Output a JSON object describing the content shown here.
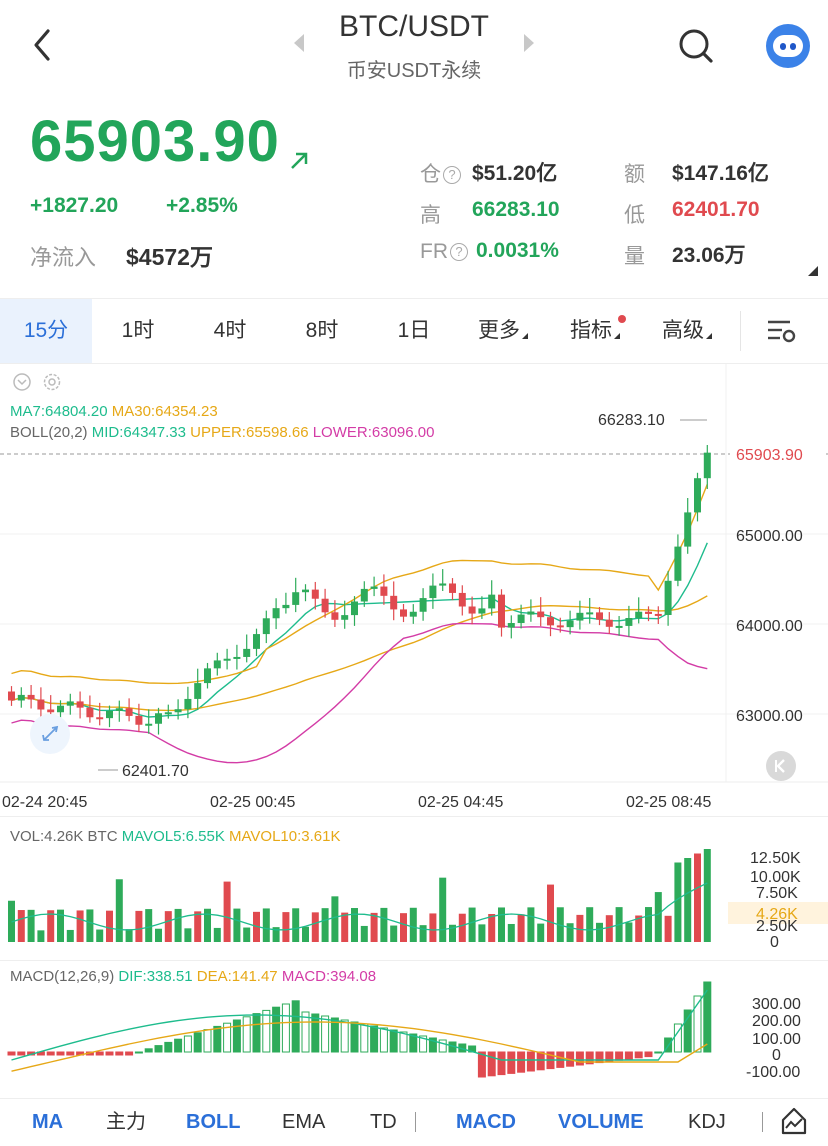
{
  "header": {
    "pair": "BTC/USDT",
    "subtitle": "币安USDT永续"
  },
  "price": {
    "last": "65903.90",
    "change": "+1827.20",
    "change_pct": "+2.85%",
    "netflow_label": "净流入",
    "netflow_value": "$4572万"
  },
  "stats": {
    "oi_label": "仓",
    "oi_value": "$51.20亿",
    "amount_label": "额",
    "amount_value": "$147.16亿",
    "high_label": "高",
    "high_value": "66283.10",
    "low_label": "低",
    "low_value": "62401.70",
    "fr_label": "FR",
    "fr_value": "0.0031%",
    "vol_label": "量",
    "vol_value": "23.06万"
  },
  "tabs": [
    {
      "label": "15分",
      "active": true
    },
    {
      "label": "1时"
    },
    {
      "label": "4时"
    },
    {
      "label": "8时"
    },
    {
      "label": "1日"
    },
    {
      "label": "更多"
    },
    {
      "label": "指标"
    },
    {
      "label": "高级"
    }
  ],
  "legend": {
    "ma7": "MA7:64804.20",
    "ma30": "MA30:64354.23",
    "boll": "BOLL(20,2)",
    "mid": "MID:64347.33",
    "upper": "UPPER:65598.66",
    "lower": "LOWER:63096.00",
    "vol": "VOL:4.26K BTC",
    "mavol5": "MAVOL5:6.55K",
    "mavol10": "MAVOL10:3.61K",
    "macd": "MACD(12,26,9)",
    "dif": "DIF:338.51",
    "dea": "DEA:141.47",
    "macd_val": "MACD:394.08"
  },
  "main_chart": {
    "high_label": "66283.10",
    "low_label": "62401.70",
    "current_label": "65903.90",
    "y_ticks": [
      "65000.00",
      "64000.00",
      "63000.00"
    ],
    "x_ticks": [
      "02-24 20:45",
      "02-25 00:45",
      "02-25 04:45",
      "02-25 08:45"
    ]
  },
  "vol_chart": {
    "y_ticks": [
      "12.50K",
      "10.00K",
      "7.50K",
      "2.50K",
      "0"
    ],
    "current": "4.26K"
  },
  "macd_chart": {
    "y_ticks": [
      "300.00",
      "200.00",
      "100.00",
      "0",
      "-100.00"
    ]
  },
  "bottom_bar": [
    "MA",
    "主力",
    "BOLL",
    "EMA",
    "TD",
    "MACD",
    "VOLUME",
    "KDJ"
  ],
  "colors": {
    "up": "#2eab5a",
    "down": "#e04a4f",
    "accent": "#2b6fd8",
    "ma7": "#1ebc8d",
    "ma30": "#e6a817",
    "lower": "#d33ca6"
  }
}
